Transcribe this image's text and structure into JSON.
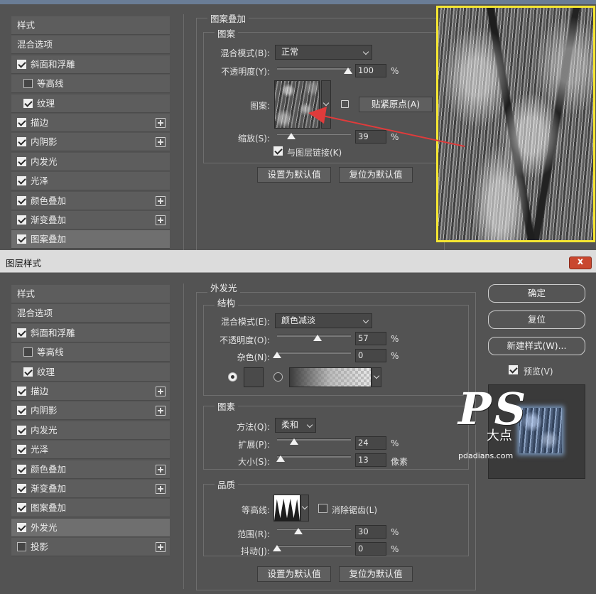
{
  "top_panel": {
    "style_list": [
      {
        "label": "样式",
        "checkbox": null,
        "plus": false
      },
      {
        "label": "混合选项",
        "checkbox": null,
        "plus": false
      },
      {
        "label": "斜面和浮雕",
        "checkbox": true,
        "plus": false
      },
      {
        "label": "等高线",
        "checkbox": false,
        "plus": false,
        "indent": true
      },
      {
        "label": "纹理",
        "checkbox": true,
        "plus": false,
        "indent": true
      },
      {
        "label": "描边",
        "checkbox": true,
        "plus": true
      },
      {
        "label": "内阴影",
        "checkbox": true,
        "plus": true
      },
      {
        "label": "内发光",
        "checkbox": true,
        "plus": false
      },
      {
        "label": "光泽",
        "checkbox": true,
        "plus": false
      },
      {
        "label": "颜色叠加",
        "checkbox": true,
        "plus": true
      },
      {
        "label": "渐变叠加",
        "checkbox": true,
        "plus": true
      },
      {
        "label": "图案叠加",
        "checkbox": true,
        "plus": false,
        "active": true
      }
    ],
    "section_title": "图案叠加",
    "group_title": "图案",
    "blend_mode_label": "混合模式(B):",
    "blend_mode_value": "正常",
    "opacity_label": "不透明度(Y):",
    "opacity_value": "100",
    "opacity_unit": "%",
    "opacity_fraction": 1.0,
    "pattern_label": "图案:",
    "snap_origin_button": "贴紧原点(A)",
    "scale_label": "缩放(S):",
    "scale_value": "39",
    "scale_unit": "%",
    "scale_fraction": 0.39,
    "link_label": "与图层链接(K)",
    "link_checked": true,
    "set_default_button": "设置为默认值",
    "reset_default_button": "复位为默认值"
  },
  "dialog": {
    "title": "图层样式",
    "close_glyph": "x",
    "style_list": [
      {
        "label": "样式",
        "checkbox": null,
        "plus": false
      },
      {
        "label": "混合选项",
        "checkbox": null,
        "plus": false
      },
      {
        "label": "斜面和浮雕",
        "checkbox": true,
        "plus": false
      },
      {
        "label": "等高线",
        "checkbox": false,
        "plus": false,
        "indent": true
      },
      {
        "label": "纹理",
        "checkbox": true,
        "plus": false,
        "indent": true
      },
      {
        "label": "描边",
        "checkbox": true,
        "plus": true
      },
      {
        "label": "内阴影",
        "checkbox": true,
        "plus": true
      },
      {
        "label": "内发光",
        "checkbox": true,
        "plus": false
      },
      {
        "label": "光泽",
        "checkbox": true,
        "plus": false
      },
      {
        "label": "颜色叠加",
        "checkbox": true,
        "plus": true
      },
      {
        "label": "渐变叠加",
        "checkbox": true,
        "plus": true
      },
      {
        "label": "图案叠加",
        "checkbox": true,
        "plus": false
      },
      {
        "label": "外发光",
        "checkbox": true,
        "plus": false,
        "active": true
      },
      {
        "label": "投影",
        "checkbox": false,
        "plus": true
      }
    ],
    "section_title": "外发光",
    "structure": {
      "title": "结构",
      "blend_mode_label": "混合模式(E):",
      "blend_mode_value": "颜色减淡",
      "opacity_label": "不透明度(O):",
      "opacity_value": "57",
      "opacity_unit": "%",
      "opacity_fraction": 0.57,
      "noise_label": "杂色(N):",
      "noise_value": "0",
      "noise_unit": "%",
      "noise_fraction": 0.0
    },
    "elements": {
      "title": "图素",
      "method_label": "方法(Q):",
      "method_value": "柔和",
      "spread_label": "扩展(P):",
      "spread_value": "24",
      "spread_unit": "%",
      "spread_fraction": 0.24,
      "size_label": "大小(S):",
      "size_value": "13",
      "size_unit": "像素",
      "size_fraction": 0.05
    },
    "quality": {
      "title": "品质",
      "contour_label": "等高线:",
      "antialias_label": "消除锯齿(L)",
      "antialias_checked": false,
      "range_label": "范围(R):",
      "range_value": "30",
      "range_unit": "%",
      "range_fraction": 0.3,
      "jitter_label": "抖动(J):",
      "jitter_value": "0",
      "jitter_unit": "%",
      "jitter_fraction": 0.0
    },
    "set_default_button": "设置为默认值",
    "reset_default_button": "复位为默认值",
    "ok_button": "确定",
    "reset_button": "复位",
    "new_style_button": "新建样式(W)...",
    "preview_label": "预览(V)",
    "preview_checked": true
  },
  "watermark": {
    "letters": "PS",
    "subtext": "大点",
    "site": "pdadians.com"
  },
  "colors": {
    "panel_bg": "#535353",
    "list_item_bg": "#5d5d5d",
    "highlight_border": "#f5e632",
    "arrow": "#e03b3b",
    "close_button": "#c9472f"
  }
}
